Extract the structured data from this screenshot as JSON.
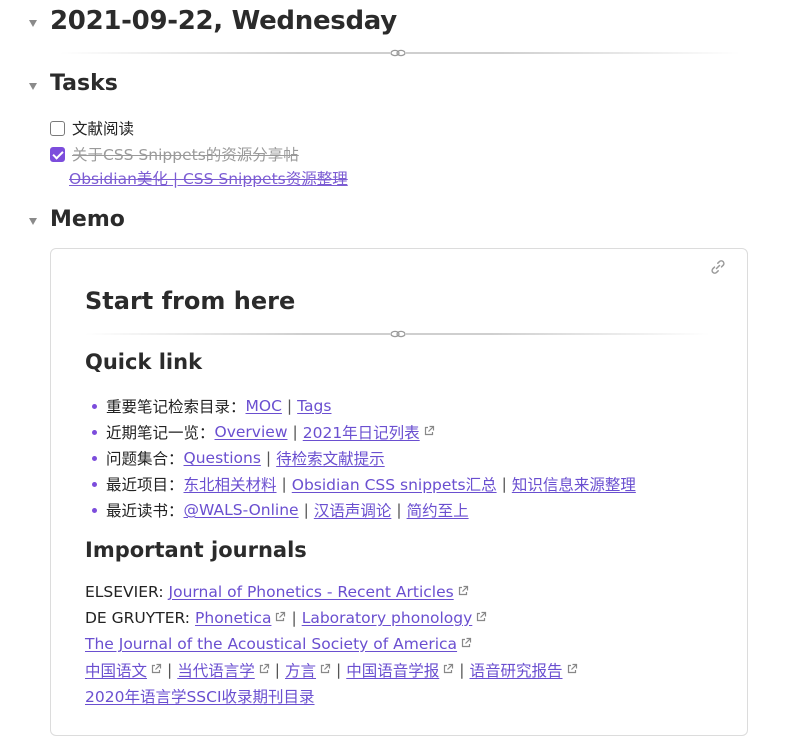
{
  "header": {
    "date_title": "2021-09-22, Wednesday"
  },
  "tasks": {
    "heading": "Tasks",
    "items": [
      {
        "label": "文献阅读",
        "checked": false
      },
      {
        "label": "关于CSS Snippets的资源分享帖",
        "checked": true
      }
    ],
    "sub_link": "Obsidian美化 | CSS Snippets资源整理"
  },
  "memo": {
    "heading": "Memo",
    "title": "Start from here",
    "quick_link": {
      "heading": "Quick link",
      "rows": [
        {
          "prefix": "重要笔记检索目录：",
          "links": [
            "MOC",
            "Tags"
          ]
        },
        {
          "prefix": "近期笔记一览：",
          "links": [
            "Overview",
            "2021年日记列表"
          ]
        },
        {
          "prefix": "问题集合：",
          "links": [
            "Questions",
            "待检索文献提示"
          ]
        },
        {
          "prefix": "最近项目：",
          "links": [
            "东北相关材料",
            "Obsidian CSS snippets汇总",
            "知识信息来源整理"
          ]
        },
        {
          "prefix": "最近读书：",
          "links": [
            "@WALS-Online",
            "汉语声调论",
            "简约至上"
          ]
        }
      ]
    },
    "journals": {
      "heading": "Important journals",
      "rows": [
        {
          "prefix": "ELSEVIER:",
          "links": [
            "Journal of Phonetics - Recent Articles"
          ]
        },
        {
          "prefix": "DE GRUYTER:",
          "links": [
            "Phonetica",
            "Laboratory phonology"
          ]
        },
        {
          "prefix": "",
          "links": [
            "The Journal of the Acoustical Society of America"
          ]
        },
        {
          "prefix": "",
          "links": [
            "中国语文",
            "当代语言学",
            "方言",
            "中国语音学报",
            "语音研究报告"
          ]
        },
        {
          "prefix": "",
          "links": [
            "2020年语言学SSCI收录期刊目录"
          ]
        }
      ]
    }
  },
  "icons": {
    "fold": "triangle-down-icon",
    "card_link": "link-icon",
    "external": "external-link-icon",
    "divider": "chain-ornament-icon"
  },
  "colors": {
    "accent": "#7c4ddc",
    "link": "#6a4fd0",
    "text": "#222222",
    "muted": "#9a9a9a"
  },
  "sep": "|"
}
